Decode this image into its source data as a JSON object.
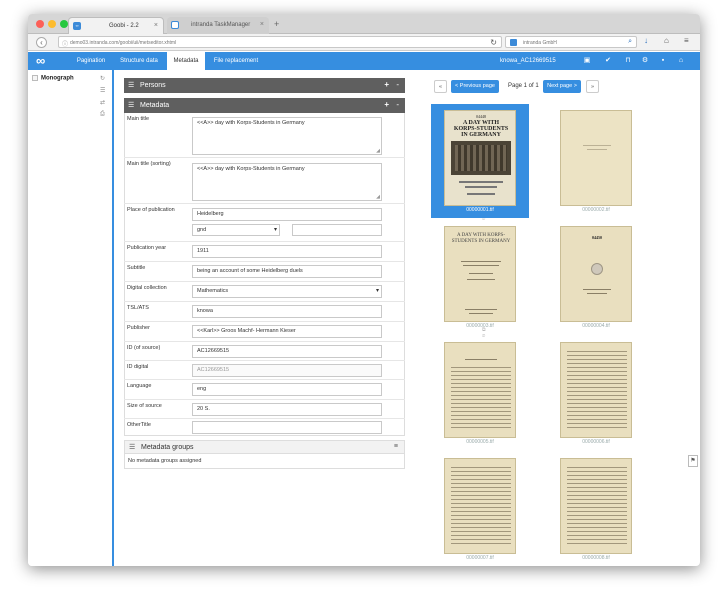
{
  "browser": {
    "tabs": [
      {
        "title": "Goobi - 2.2",
        "favicon": "goobi-favicon"
      },
      {
        "title": "intranda TaskManager",
        "favicon": "intranda-favicon"
      }
    ],
    "url": "demo03.intranda.com/goobi/uii/metseditor.xhtml",
    "search_engine_label": "intranda GmbH"
  },
  "app": {
    "logo": "∞",
    "nav": [
      "Pagination",
      "Structure data",
      "Metadata",
      "File replacement"
    ],
    "active_nav": "Metadata",
    "document_id": "knowa_AC12669515",
    "header_icons": [
      "image-icon",
      "check-icon",
      "unlock-icon",
      "gear-icon",
      "save-icon",
      "home-icon"
    ]
  },
  "sidebar": {
    "tree_root": "Monograph"
  },
  "persons": {
    "title": "Persons",
    "plus": "+",
    "minus": "-"
  },
  "metadata": {
    "title": "Metadata",
    "plus": "+",
    "minus": "-",
    "fields": {
      "main_title": {
        "label": "Main title",
        "value": "<<A>> day with Korps-Students in Germany"
      },
      "main_title_sorting": {
        "label": "Main title (sorting)",
        "value": "<<A>> day with Korps-Students in Germany"
      },
      "place": {
        "label": "Place of publication",
        "value": "Heidelberg",
        "authority": "gnd",
        "authority_value": ""
      },
      "year": {
        "label": "Publication year",
        "value": "1911"
      },
      "subtitle": {
        "label": "Subtitle",
        "value": "being an account of some Heidelberg duels"
      },
      "digital_collection": {
        "label": "Digital collection",
        "value": "Mathematics"
      },
      "tsl_ats": {
        "label": "TSL/ATS",
        "value": "knowa"
      },
      "publisher": {
        "label": "Publisher",
        "value": "<<Karl>> Groos Machf- Hermann Kieser"
      },
      "id_source": {
        "label": "ID (of source)",
        "value": "AC12669515"
      },
      "id_digital": {
        "label": "ID digital",
        "value": "AC12669515"
      },
      "language": {
        "label": "Language",
        "value": "eng"
      },
      "size_source": {
        "label": "Size of source",
        "value": "20 S."
      },
      "other_title": {
        "label": "OtherTitle",
        "value": ""
      }
    }
  },
  "metadata_groups": {
    "title": "Metadata groups",
    "empty_text": "No metadata groups assigned"
  },
  "images": {
    "prev_label": "< Previous page",
    "page_info": "Page 1 of 1",
    "next_label": "Next page >",
    "first_label": "«",
    "last_label": "»",
    "thumbnails": [
      {
        "file": "00000001.tif"
      },
      {
        "file": "00000002.tif"
      },
      {
        "file": "00000003.tif"
      },
      {
        "file": "00000004.tif"
      },
      {
        "file": "00000005.tif"
      },
      {
        "file": "00000006.tif"
      },
      {
        "file": "00000007.tif"
      },
      {
        "file": "00000008.tif"
      }
    ],
    "selected_index": 0,
    "cover_text": "A DAY WITH KORPS-STUDENTS IN GERMANY",
    "cover_number": "04448",
    "page_number": "04450"
  },
  "colors": {
    "accent": "#368ee0",
    "box_header": "#5f5f5f"
  }
}
